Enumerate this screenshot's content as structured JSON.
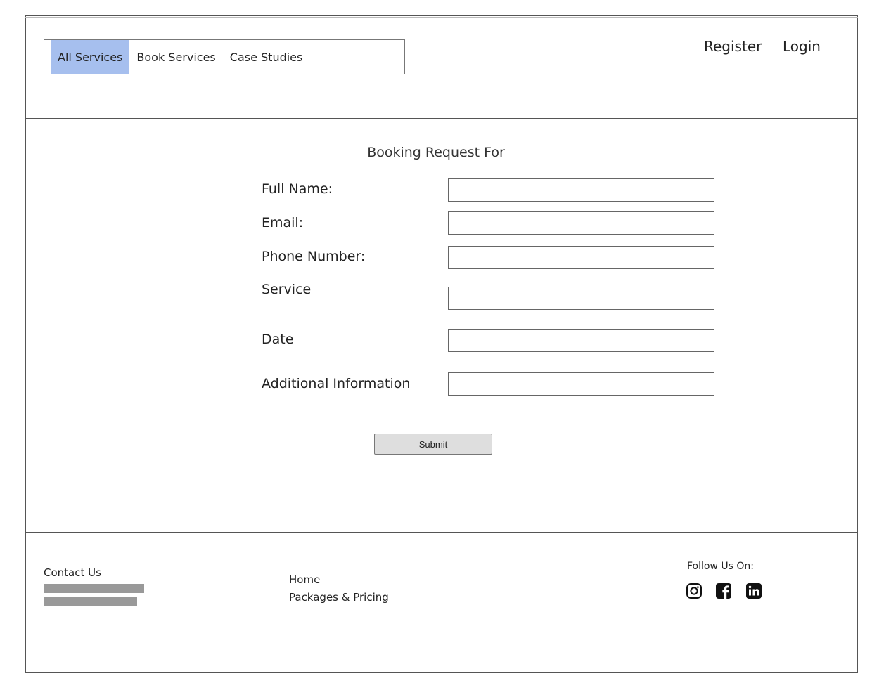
{
  "header": {
    "tabs": [
      {
        "label": "All Services",
        "active": true
      },
      {
        "label": "Book Services",
        "active": false
      },
      {
        "label": "Case Studies",
        "active": false
      }
    ],
    "register_label": "Register",
    "login_label": "Login"
  },
  "form": {
    "title": "Booking Request For",
    "fields": [
      {
        "label": "Full Name:",
        "value": ""
      },
      {
        "label": "Email:",
        "value": ""
      },
      {
        "label": "Phone Number:",
        "value": ""
      },
      {
        "label": "Service",
        "value": ""
      },
      {
        "label": "Date",
        "value": ""
      },
      {
        "label": "Additional Information",
        "value": ""
      }
    ],
    "submit_label": "Submit"
  },
  "footer": {
    "contact_title": "Contact Us",
    "links": [
      "Home",
      "Packages & Pricing"
    ],
    "follow_title": "Follow Us On:",
    "social_icons": [
      "instagram-icon",
      "facebook-icon",
      "linkedin-icon"
    ]
  },
  "colors": {
    "active_tab": "#a6bfee",
    "placeholder_bar": "#999999",
    "button_bg": "#dedede"
  }
}
